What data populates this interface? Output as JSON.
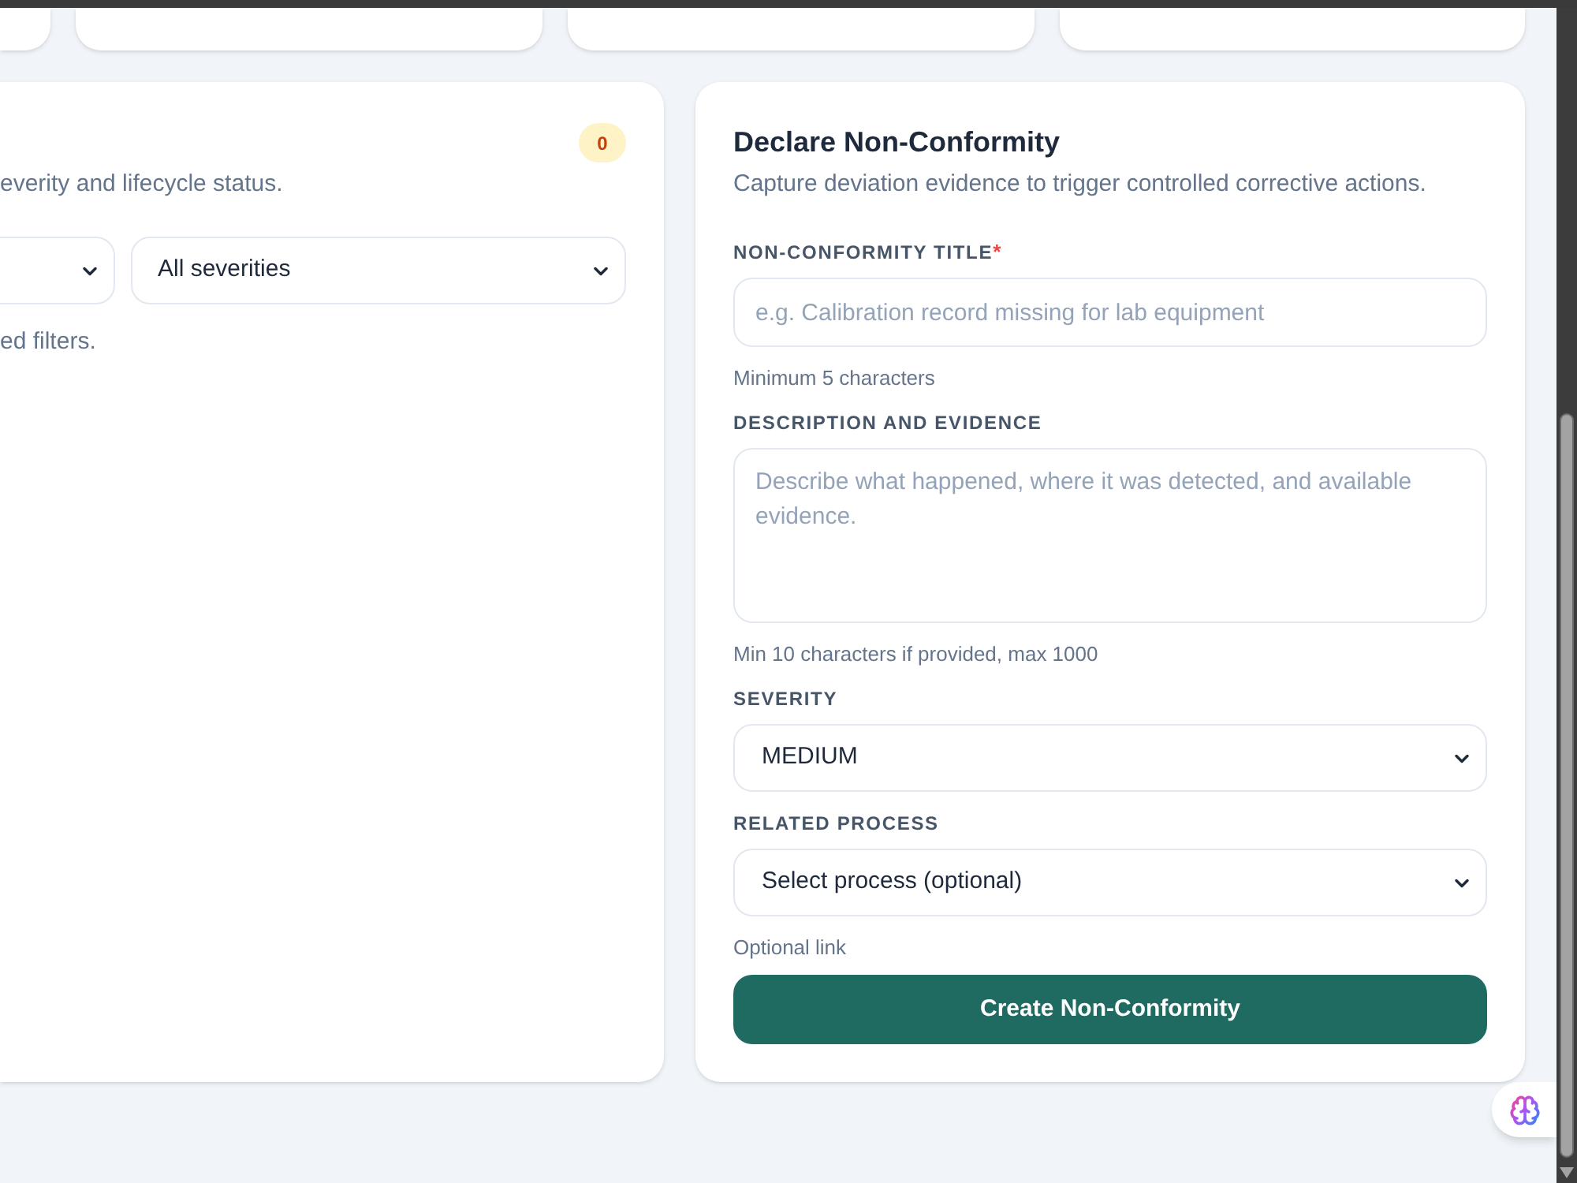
{
  "list_panel": {
    "count_badge": "0",
    "description": "everity and lifecycle status.",
    "severity_filter": {
      "value": "All severities"
    },
    "empty_message": "ed filters."
  },
  "form": {
    "title": "Declare Non-Conformity",
    "subtitle": "Capture deviation evidence to trigger controlled corrective actions.",
    "fields": [
      {
        "kind": "input",
        "label": "NON-CONFORMITY TITLE",
        "required_mark": "*",
        "placeholder": "e.g. Calibration record missing for lab equipment",
        "hint": "Minimum 5 characters"
      },
      {
        "kind": "textarea",
        "label": "DESCRIPTION AND EVIDENCE",
        "placeholder": "Describe what happened, where it was detected, and available evidence.",
        "hint": "Min 10 characters if provided, max 1000"
      },
      {
        "kind": "select",
        "label": "SEVERITY",
        "value": "MEDIUM"
      },
      {
        "kind": "select",
        "label": "RELATED PROCESS",
        "value": "Select process (optional)",
        "hint": "Optional link"
      }
    ],
    "submit_button": "Create Non-Conformity"
  }
}
